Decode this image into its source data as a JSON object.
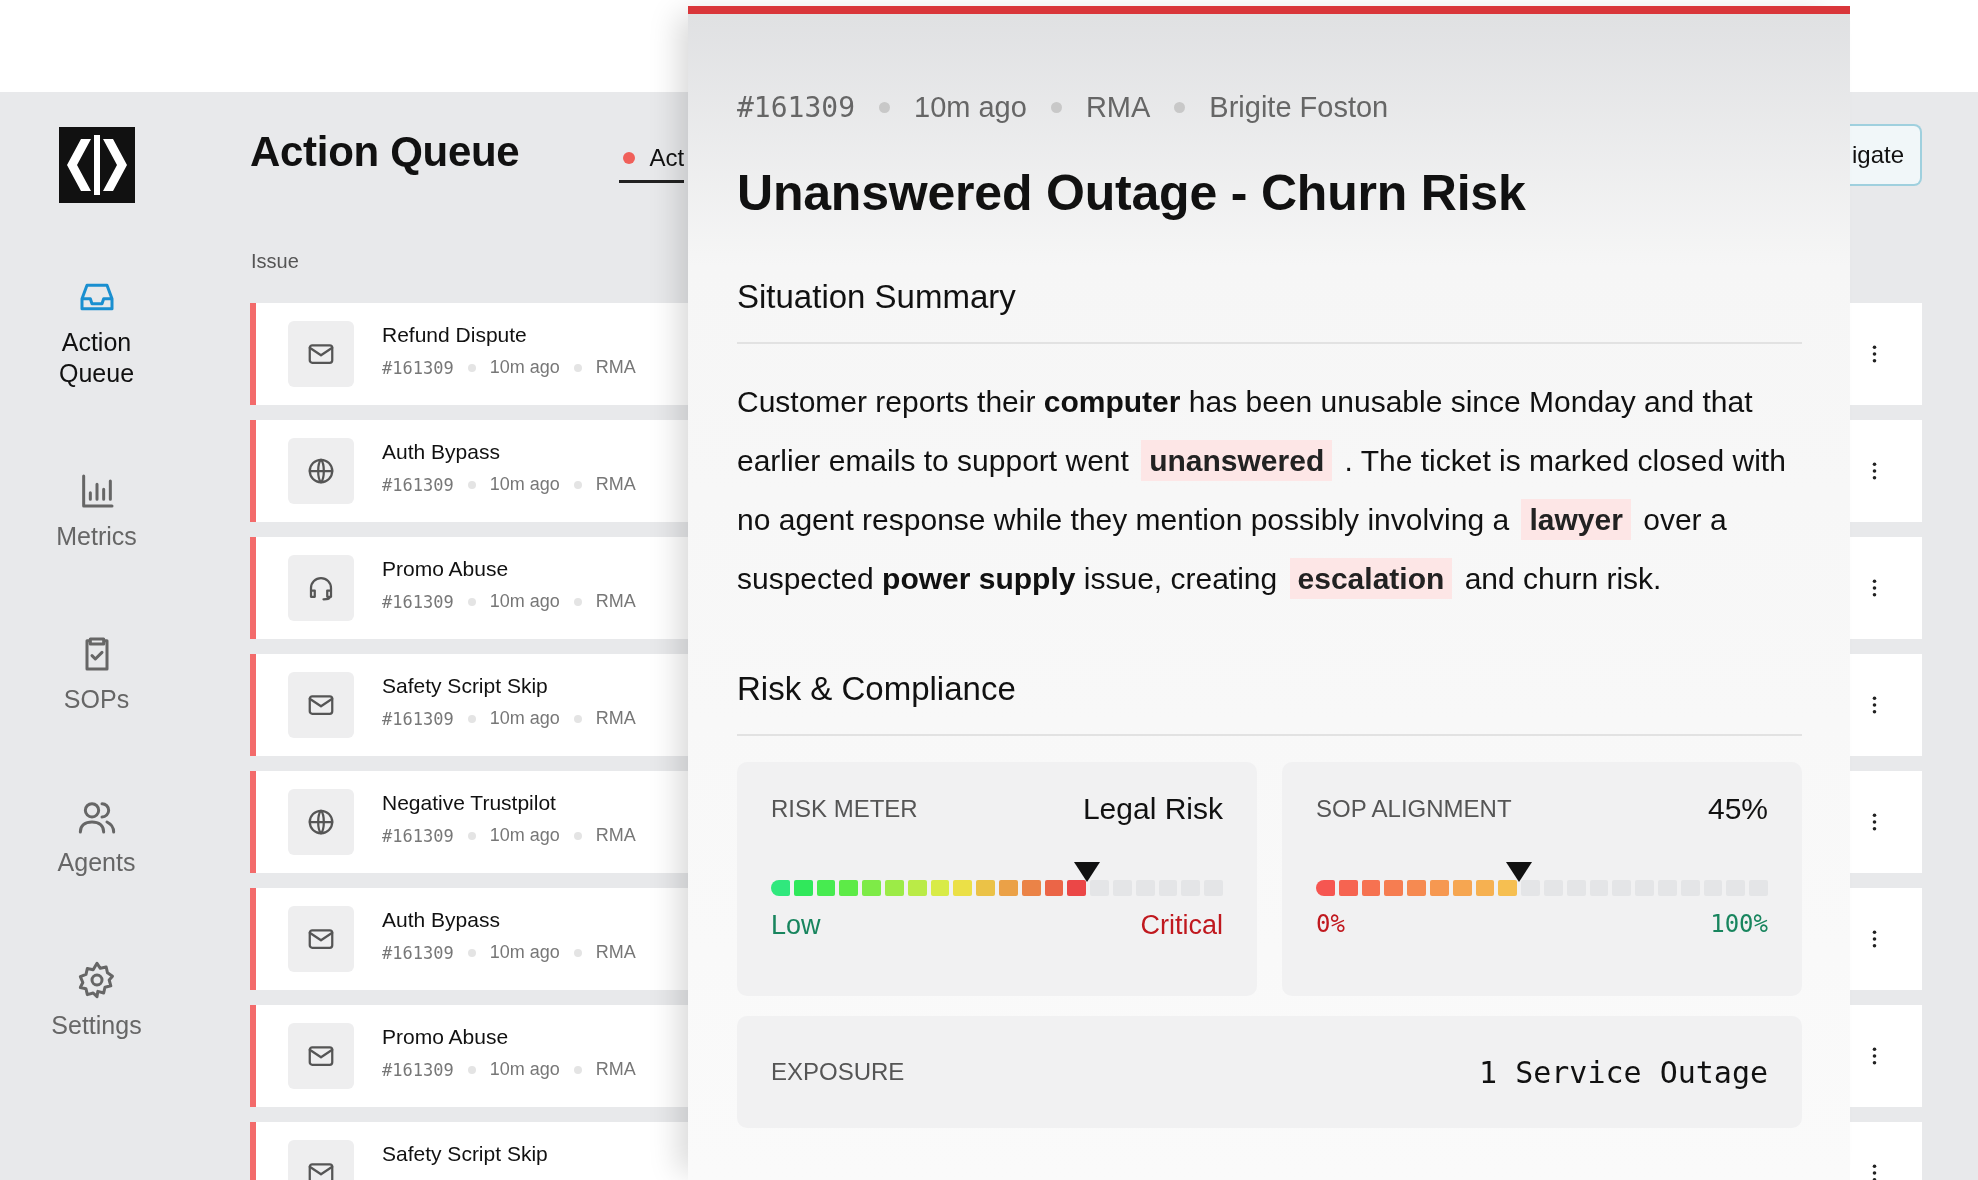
{
  "sidebar": {
    "items": [
      {
        "label": "Action Queue",
        "kind": "inbox",
        "selected": true
      },
      {
        "label": "Metrics",
        "kind": "chart",
        "selected": false
      },
      {
        "label": "SOPs",
        "kind": "clipboard",
        "selected": false
      },
      {
        "label": "Agents",
        "kind": "people",
        "selected": false
      },
      {
        "label": "Settings",
        "kind": "gear",
        "selected": false
      }
    ]
  },
  "header": {
    "title": "Action Queue",
    "tab": "Act",
    "button": "igate"
  },
  "table": {
    "column_1": "Issue",
    "rows": [
      {
        "kind": "email",
        "title": "Refund Dispute",
        "id": "#161309",
        "time": "10m ago",
        "type": "RMA"
      },
      {
        "kind": "web",
        "title": "Auth Bypass",
        "id": "#161309",
        "time": "10m ago",
        "type": "RMA"
      },
      {
        "kind": "phone",
        "title": "Promo Abuse",
        "id": "#161309",
        "time": "10m ago",
        "type": "RMA"
      },
      {
        "kind": "email",
        "title": "Safety Script Skip",
        "id": "#161309",
        "time": "10m ago",
        "type": "RMA"
      },
      {
        "kind": "web",
        "title": "Negative Trustpilot",
        "id": "#161309",
        "time": "10m ago",
        "type": "RMA"
      },
      {
        "kind": "email",
        "title": "Auth Bypass",
        "id": "#161309",
        "time": "10m ago",
        "type": "RMA"
      },
      {
        "kind": "email",
        "title": "Promo Abuse",
        "id": "#161309",
        "time": "10m ago",
        "type": "RMA"
      },
      {
        "kind": "email",
        "title": "Safety Script Skip"
      }
    ]
  },
  "detail": {
    "meta": [
      "#161309",
      "10m ago",
      "RMA",
      "Brigite Foston"
    ],
    "title": "Unanswered Outage - Churn Risk",
    "summary_heading": "Situation Summary",
    "summary": [
      {
        "kind": "plain",
        "text": "Customer reports their "
      },
      {
        "kind": "bold",
        "text": "computer"
      },
      {
        "kind": "plain",
        "text": " has been unusable since Monday and that earlier emails to support went "
      },
      {
        "kind": "highlight",
        "text": "unanswered"
      },
      {
        "kind": "plain",
        "text": " . The ticket is marked closed with no agent response while they mention possibly involving a "
      },
      {
        "kind": "highlight",
        "text": "lawyer"
      },
      {
        "kind": "plain",
        "text": " over a suspected "
      },
      {
        "kind": "bold",
        "text": "power supply"
      },
      {
        "kind": "plain",
        "text": " issue, creating "
      },
      {
        "kind": "highlight",
        "text": "escalation"
      },
      {
        "kind": "plain",
        "text": " and churn risk."
      }
    ],
    "risk_heading": "Risk & Compliance",
    "meters": [
      {
        "kind": "risk",
        "label": "RISK METER",
        "value": "Legal Risk",
        "level": 0.7,
        "low": "Low",
        "high": "Critical"
      },
      {
        "kind": "alignment",
        "label": "SOP ALIGNMENT",
        "value": "45%",
        "level": 0.45,
        "low": "0%",
        "high": "100%"
      }
    ],
    "exposure": {
      "label": "EXPOSURE",
      "value": "1 Service Outage"
    }
  }
}
